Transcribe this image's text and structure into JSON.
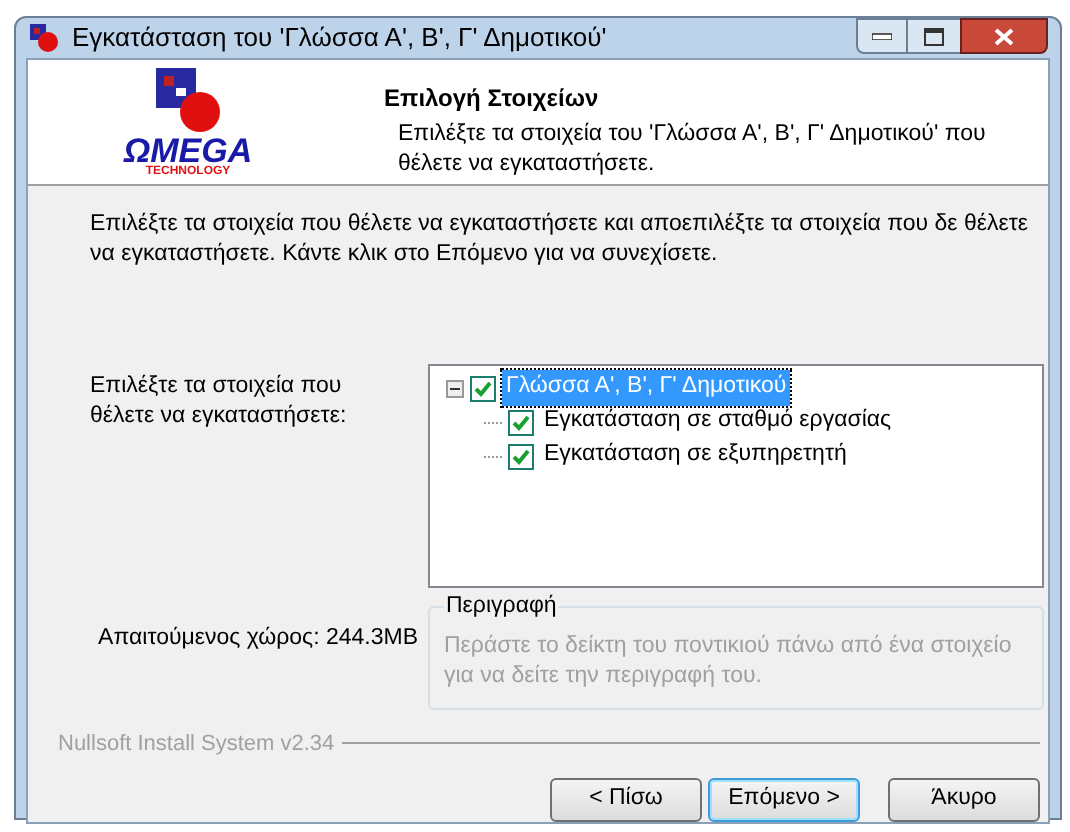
{
  "window": {
    "title": "Εγκατάσταση του 'Γλώσσα Α', Β', Γ' Δημοτικού'"
  },
  "header": {
    "title": "Επιλογή Στοιχείων",
    "subtitle": "Επιλέξτε τα στοιχεία του 'Γλώσσα Α', Β', Γ' Δημοτικού' που θέλετε να εγκαταστήσετε.",
    "logo_text": "ΩMEGA",
    "logo_subtext": "TECHNOLOGY"
  },
  "intro": "Επιλέξτε τα στοιχεία που θέλετε να εγκαταστήσετε και αποεπιλέξτε τα στοιχεία που δε θέλετε να εγκαταστήσετε. Κάντε κλικ στο Επόμενο για να συνεχίσετε.",
  "select_label": "Επιλέξτε τα στοιχεία που θέλετε να εγκαταστήσετε:",
  "tree": [
    {
      "label": "Γλώσσα Α', Β', Γ' Δημοτικού",
      "checked": true,
      "selected": true,
      "expanded": true,
      "children": [
        {
          "label": "Εγκατάσταση σε σταθμό εργασίας",
          "checked": true,
          "selected": false
        },
        {
          "label": "Εγκατάσταση σε εξυπηρετητή",
          "checked": true,
          "selected": false
        }
      ]
    }
  ],
  "space_required": "Απαιτούμενος χώρος: 244.3MB",
  "description": {
    "title": "Περιγραφή",
    "text": "Περάστε το δείκτη του ποντικιού πάνω από ένα στοιχείο για να δείτε την περιγραφή του."
  },
  "branding": "Nullsoft Install System v2.34",
  "buttons": [
    {
      "label": "< Πίσω",
      "default": false
    },
    {
      "label": "Επόμενο >",
      "default": true
    },
    {
      "label": "Άκυρο",
      "default": false
    }
  ]
}
